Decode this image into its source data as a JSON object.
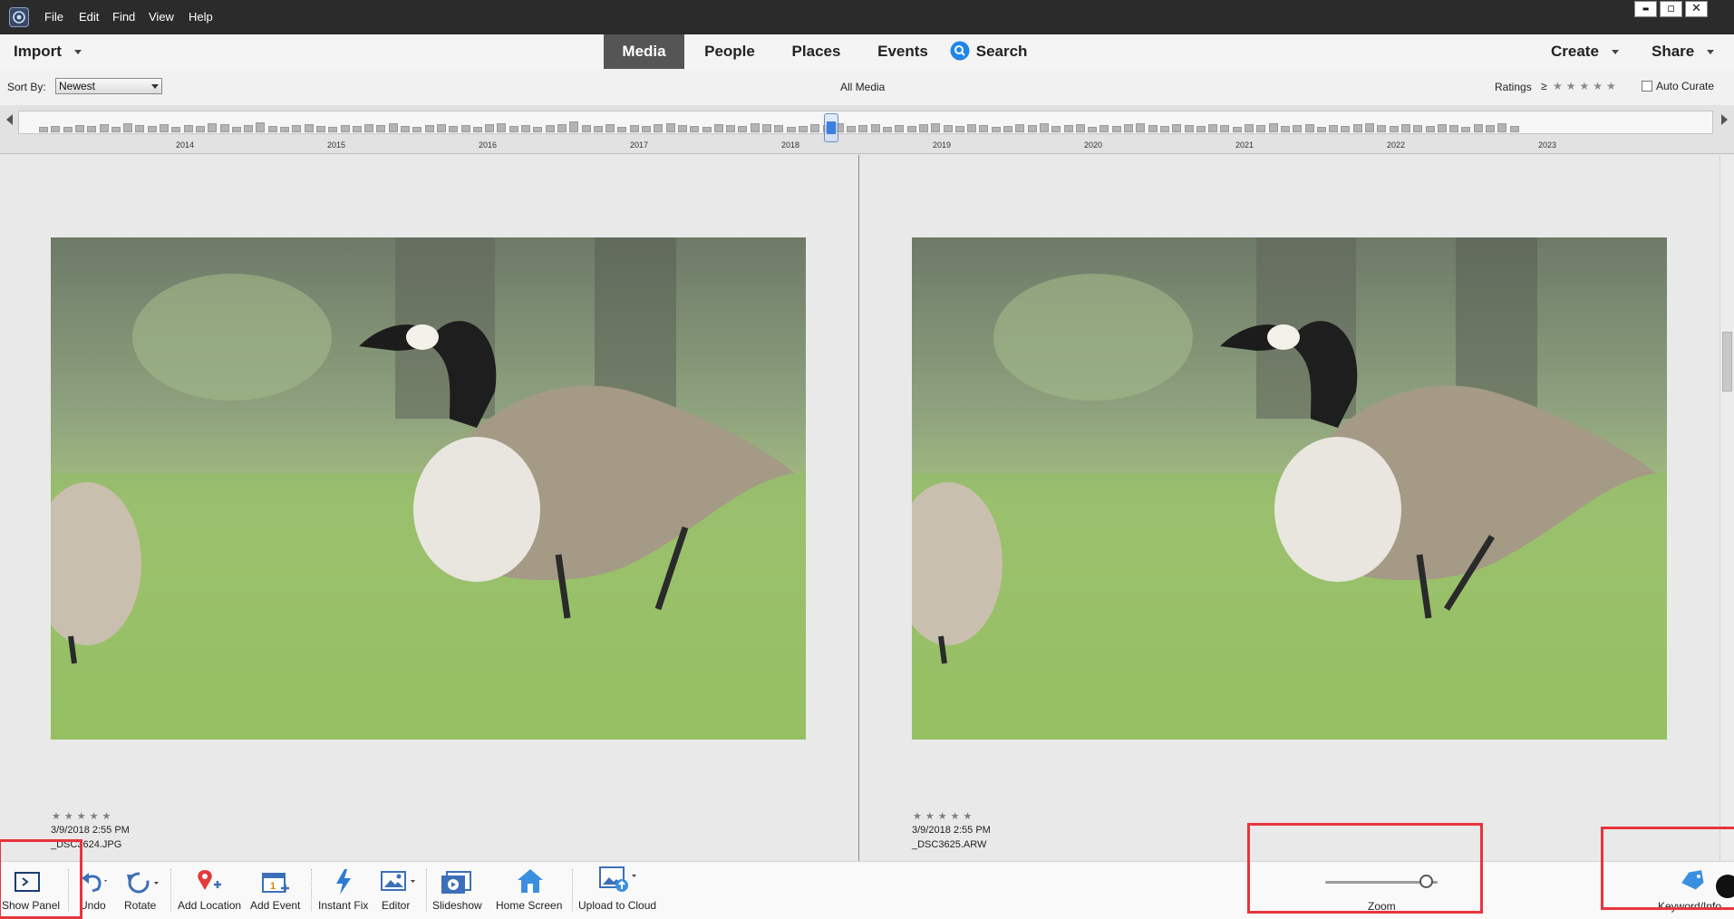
{
  "menu": [
    "File",
    "Edit",
    "Find",
    "View",
    "Help"
  ],
  "window_controls": {
    "minimize": "▬",
    "maximize": "▫",
    "close": "✕"
  },
  "nav": {
    "import_label": "Import",
    "tabs": [
      "Media",
      "People",
      "Places",
      "Events"
    ],
    "active_tab": "Media",
    "search_label": "Search",
    "create_label": "Create",
    "share_label": "Share"
  },
  "sortbar": {
    "sort_by_label": "Sort By:",
    "sort_value": "Newest",
    "view_title": "All Media",
    "ratings_label": "Ratings",
    "ratings_op": "≥",
    "ratings_stars": "★★★★★",
    "auto_curate_label": "Auto Curate"
  },
  "timeline": {
    "years": [
      "2014",
      "2015",
      "2016",
      "2017",
      "2018",
      "2019",
      "2020",
      "2021",
      "2022",
      "2023"
    ],
    "selected_year": "2018"
  },
  "photos": [
    {
      "stars": "★★★★★",
      "date": "3/9/2018 2:55 PM",
      "filename": "_DSC3624.JPG"
    },
    {
      "stars": "★★★★★",
      "date": "3/9/2018 2:55 PM",
      "filename": "_DSC3625.ARW"
    }
  ],
  "toolbar": {
    "show_panel": "Show Panel",
    "undo": "Undo",
    "rotate": "Rotate",
    "add_location": "Add Location",
    "add_event": "Add Event",
    "instant_fix": "Instant Fix",
    "editor": "Editor",
    "slideshow": "Slideshow",
    "home_screen": "Home Screen",
    "upload_to_cloud": "Upload to Cloud",
    "zoom": "Zoom",
    "zoom_level": 0.9,
    "keyword_info": "Keyword/Info"
  },
  "colors": {
    "active_tab_bg": "#555555",
    "accent_blue": "#1f87e8",
    "highlight_red": "#e8343c",
    "titlebar": "#2b2b2b"
  },
  "icons": [
    "app-logo-icon",
    "search-icon",
    "show-panel-icon",
    "undo-icon",
    "rotate-icon",
    "location-pin-icon",
    "calendar-add-icon",
    "lightning-icon",
    "editor-icon",
    "slideshow-icon",
    "home-icon",
    "cloud-upload-icon",
    "tag-icon"
  ]
}
